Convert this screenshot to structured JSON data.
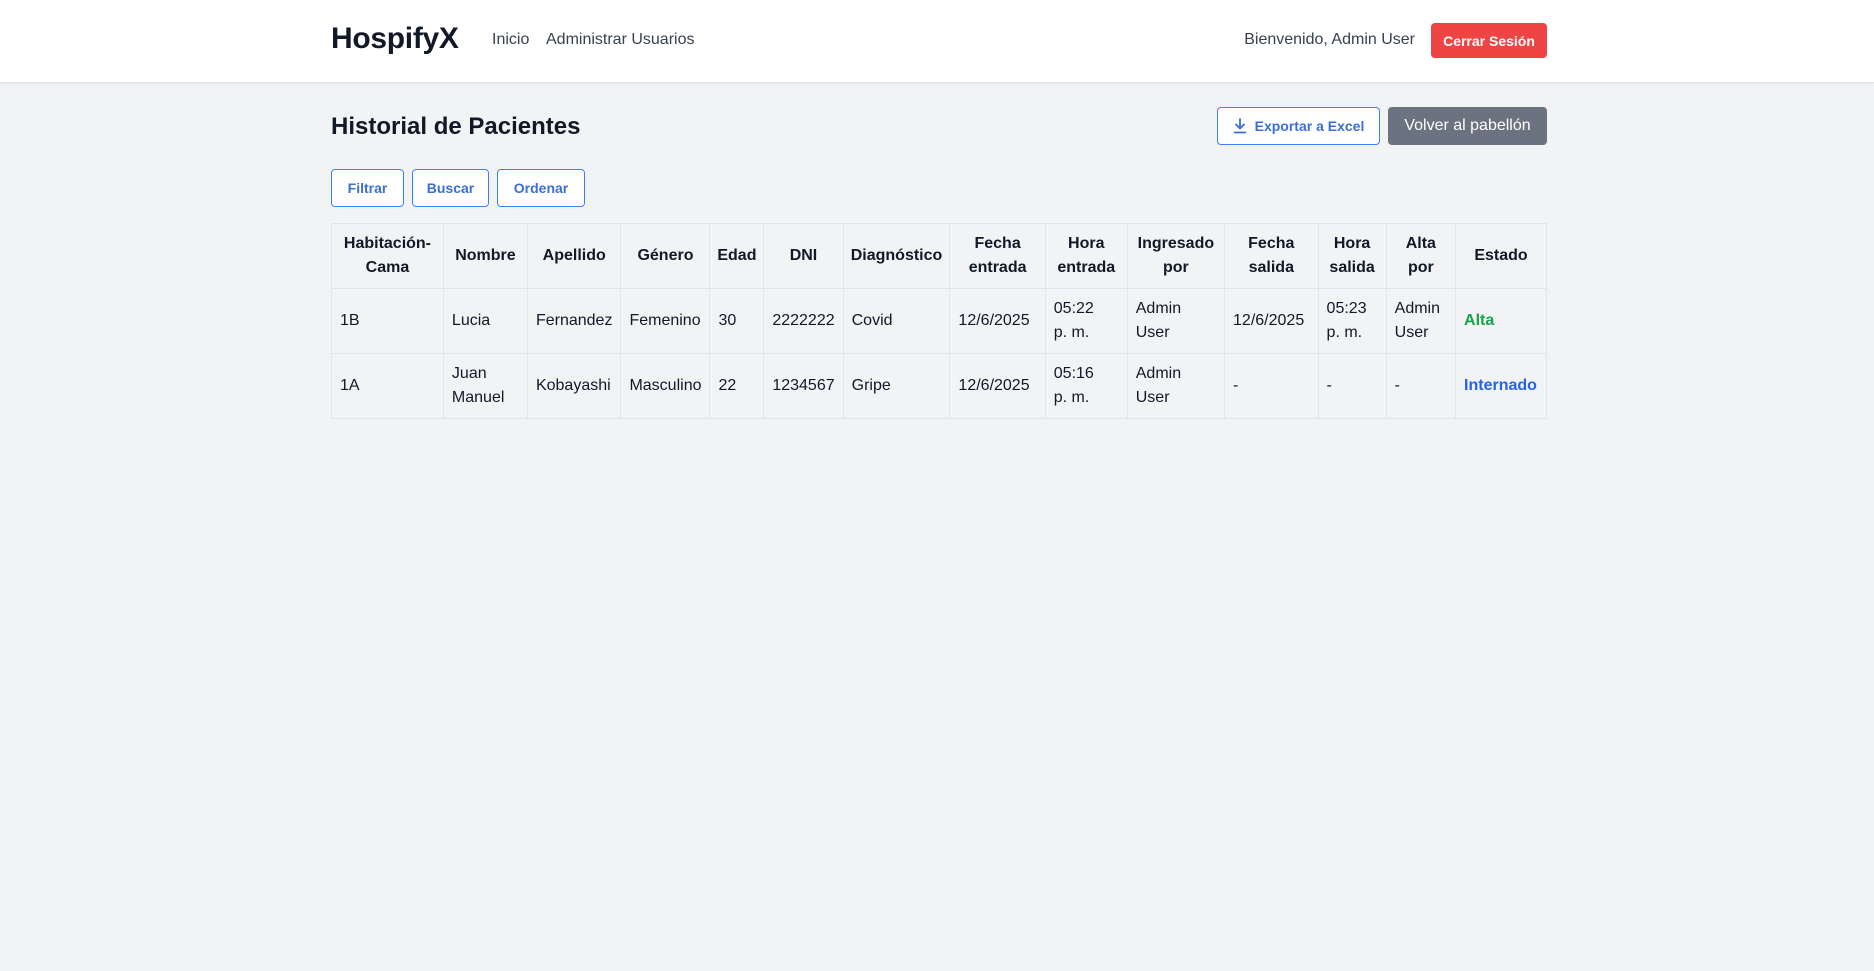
{
  "brand": "HospifyX",
  "nav": {
    "links": [
      "Inicio",
      "Administrar Usuarios"
    ],
    "welcome": "Bienvenido, Admin User",
    "logout_label": "Cerrar Sesión"
  },
  "page": {
    "title": "Historial de Pacientes",
    "export_label": "Exportar a Excel",
    "back_label": "Volver al pabellón"
  },
  "toolbar": {
    "filter_label": "Filtrar",
    "search_label": "Buscar",
    "sort_label": "Ordenar"
  },
  "table": {
    "headers": [
      [
        "Habitación-",
        "Cama"
      ],
      [
        "Nombre"
      ],
      [
        "Apellido"
      ],
      [
        "Género"
      ],
      [
        "Edad"
      ],
      [
        "DNI"
      ],
      [
        "Diagnóstico"
      ],
      [
        "Fecha",
        "entrada"
      ],
      [
        "Hora",
        "entrada"
      ],
      [
        "Ingresado",
        "por"
      ],
      [
        "Fecha",
        "salida"
      ],
      [
        "Hora",
        "salida"
      ],
      [
        "Alta",
        "por"
      ],
      [
        "Estado"
      ]
    ],
    "rows": [
      {
        "cells": [
          [
            "1B"
          ],
          [
            "Lucia"
          ],
          [
            "Fernandez"
          ],
          [
            "Femenino"
          ],
          [
            "30"
          ],
          [
            "2222222"
          ],
          [
            "Covid"
          ],
          [
            "12/6/2025"
          ],
          [
            "05:22",
            "p. m."
          ],
          [
            "Admin",
            "User"
          ],
          [
            "12/6/2025"
          ],
          [
            "05:23",
            "p. m."
          ],
          [
            "Admin",
            "User"
          ]
        ],
        "estado": "Alta",
        "estado_color": "#16a34a"
      },
      {
        "cells": [
          [
            "1A"
          ],
          [
            "Juan",
            "Manuel"
          ],
          [
            "Kobayashi"
          ],
          [
            "Masculino"
          ],
          [
            "22"
          ],
          [
            "1234567"
          ],
          [
            "Gripe"
          ],
          [
            "12/6/2025"
          ],
          [
            "05:16",
            "p. m."
          ],
          [
            "Admin",
            "User"
          ],
          [
            "-"
          ],
          [
            "-"
          ],
          [
            "-"
          ]
        ],
        "estado": "Internado",
        "estado_color": "#2563eb"
      }
    ]
  },
  "colors": {
    "logout": "#ef4444",
    "primary_outline": "#3b82f6",
    "back_button": "#6b7280",
    "background": "#f2f3f5"
  },
  "icons": {
    "export": "download-icon"
  }
}
